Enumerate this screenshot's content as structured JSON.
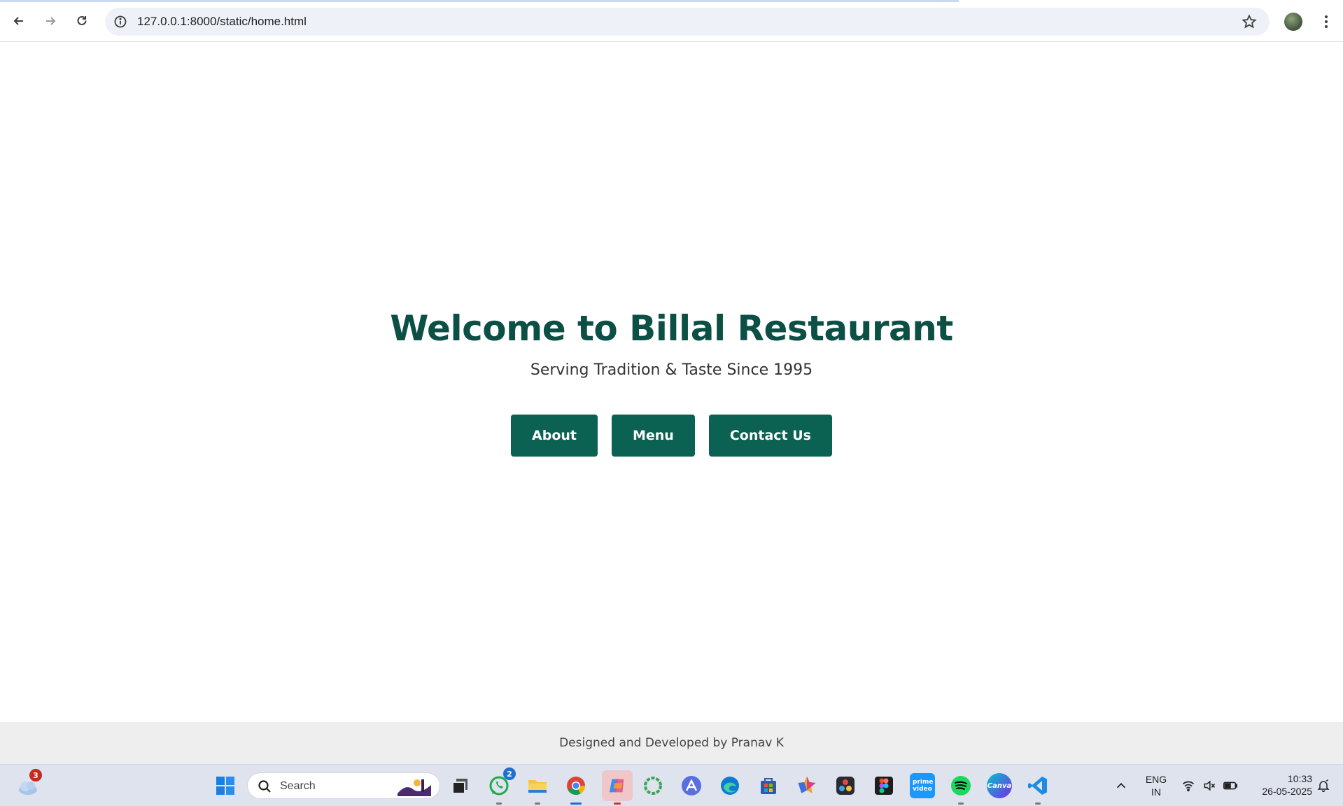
{
  "browser": {
    "url": "127.0.0.1:8000/static/home.html",
    "icons": [
      "back-arrow-icon",
      "forward-arrow-icon",
      "reload-icon",
      "site-info-icon",
      "bookmark-star-icon",
      "profile-avatar",
      "more-menu-icon"
    ]
  },
  "page": {
    "title": "Welcome to Billal Restaurant",
    "tagline": "Serving Tradition & Taste Since 1995",
    "buttons": [
      {
        "label": "About"
      },
      {
        "label": "Menu"
      },
      {
        "label": "Contact Us"
      }
    ],
    "footer": "Designed and Developed by Pranav K",
    "colors": {
      "heading": "#0b4f45",
      "button": "#0b6152",
      "footer_bg": "#eeeeee"
    }
  },
  "taskbar": {
    "weather_badge": "3",
    "search_placeholder": "Search",
    "whatsapp_badge": "2",
    "apps": [
      "weather-icon",
      "windows-start-icon",
      "task-view-icon",
      "whatsapp-icon",
      "file-explorer-icon",
      "chrome-icon",
      "copilot-icon",
      "loader-app-icon",
      "arc-app-icon",
      "edge-icon",
      "microsoft-store-icon",
      "star-app-icon",
      "davinci-resolve-icon",
      "figma-icon",
      "prime-video-icon",
      "spotify-icon",
      "canva-icon",
      "vscode-icon"
    ],
    "prime_label": "prime video",
    "canva_label": "Canva",
    "language": "ENG",
    "region": "IN",
    "time": "10:33",
    "date": "26-05-2025"
  }
}
